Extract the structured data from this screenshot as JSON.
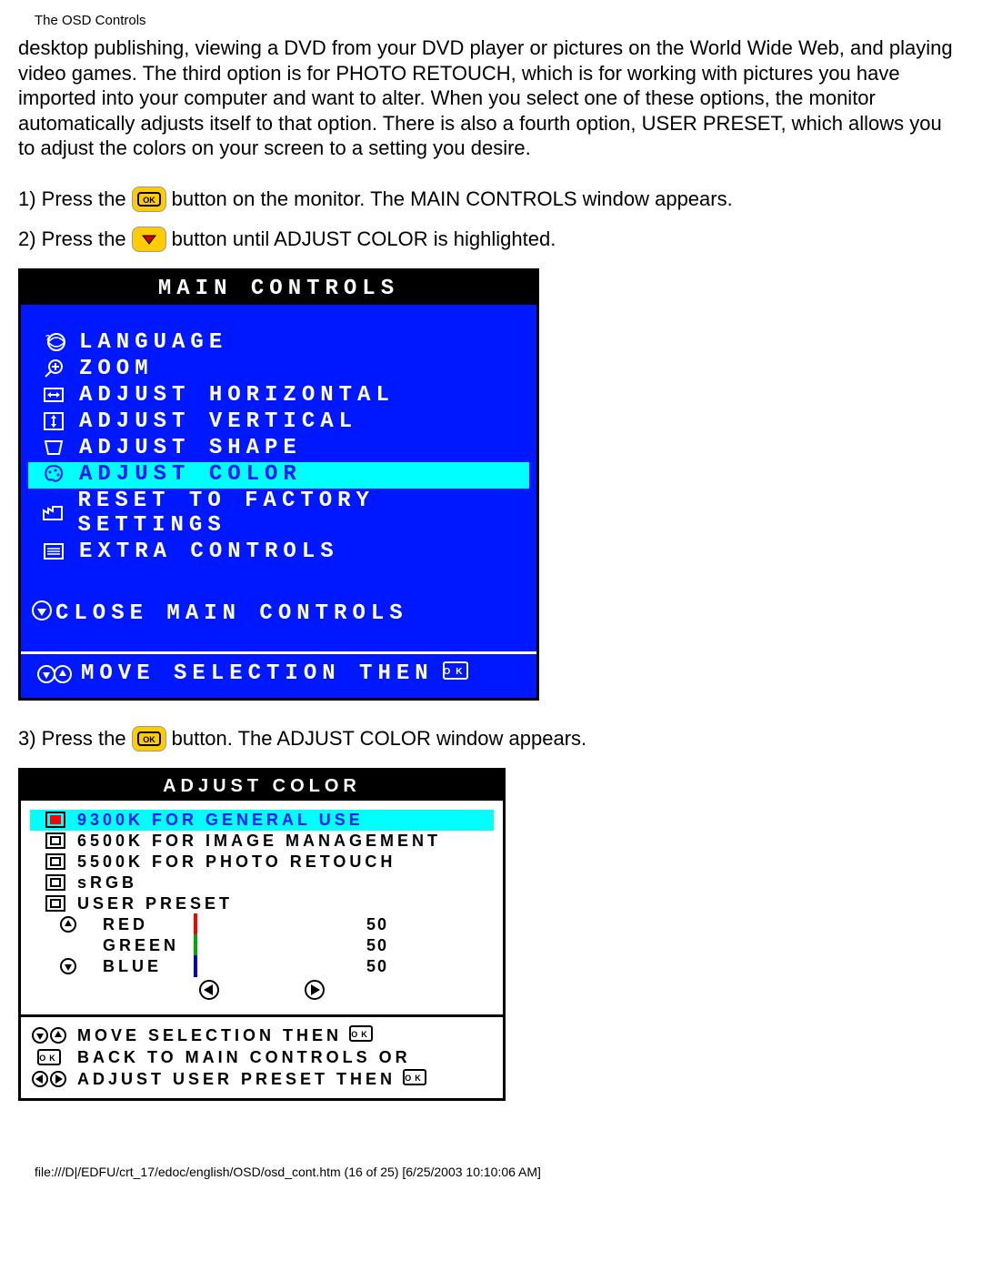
{
  "header": "The OSD Controls",
  "intro": "desktop publishing, viewing a DVD from your DVD player or pictures on the World Wide Web, and playing video games. The third option is for PHOTO RETOUCH, which is for working with pictures you have imported into your computer and want to alter. When you select one of these options, the monitor automatically adjusts itself to that option. There is also a fourth option, USER PRESET, which allows you to adjust the colors on your screen to a setting you desire.",
  "steps": {
    "s1a": "1) Press the",
    "s1b": "button on the monitor. The MAIN CONTROLS window appears.",
    "s2a": "2) Press the",
    "s2b": "button until ADJUST COLOR is highlighted.",
    "s3a": "3) Press the",
    "s3b": "button. The ADJUST COLOR window appears."
  },
  "osd1": {
    "title": "MAIN CONTROLS",
    "items": [
      {
        "label": "LANGUAGE"
      },
      {
        "label": "ZOOM"
      },
      {
        "label": "ADJUST HORIZONTAL"
      },
      {
        "label": "ADJUST VERTICAL"
      },
      {
        "label": "ADJUST SHAPE"
      },
      {
        "label": "ADJUST COLOR"
      },
      {
        "label": "RESET TO FACTORY SETTINGS"
      },
      {
        "label": "EXTRA CONTROLS"
      }
    ],
    "close": "CLOSE MAIN CONTROLS",
    "footer": "MOVE SELECTION THEN"
  },
  "osd2": {
    "title": "ADJUST COLOR",
    "items": [
      {
        "label": "9300K FOR GENERAL USE"
      },
      {
        "label": "6500K FOR IMAGE MANAGEMENT"
      },
      {
        "label": "5500K FOR PHOTO RETOUCH"
      },
      {
        "label": "sRGB"
      },
      {
        "label": "USER PRESET"
      }
    ],
    "sliders": {
      "red": {
        "label": "RED",
        "value": "50"
      },
      "green": {
        "label": "GREEN",
        "value": "50"
      },
      "blue": {
        "label": "BLUE",
        "value": "50"
      }
    },
    "footer": {
      "l1": "MOVE SELECTION THEN",
      "l2": "BACK TO MAIN CONTROLS OR",
      "l3": "ADJUST USER PRESET THEN"
    }
  },
  "footer_path": "file:///D|/EDFU/crt_17/edoc/english/OSD/osd_cont.htm (16 of 25) [6/25/2003 10:10:06 AM]"
}
